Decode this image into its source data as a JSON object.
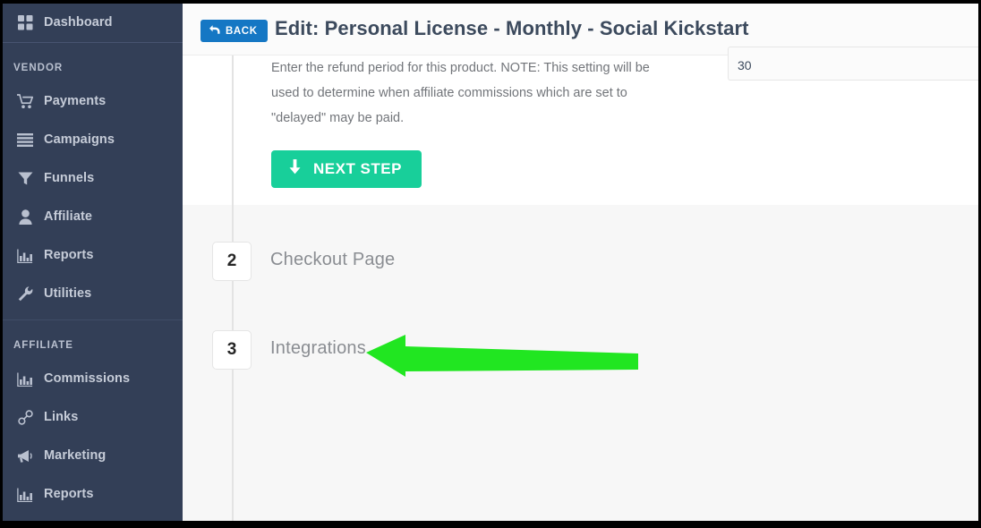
{
  "colors": {
    "sidebar_bg": "#333f57",
    "accent_blue": "#1577c4",
    "accent_green": "#18cf9a",
    "annotation_green": "#21e621",
    "title_text": "#3c4a5d"
  },
  "sidebar": {
    "primary": [
      {
        "label": "Dashboard",
        "icon": "grid-icon"
      }
    ],
    "sections": [
      {
        "heading": "VENDOR",
        "items": [
          {
            "label": "Payments",
            "icon": "cart-icon"
          },
          {
            "label": "Campaigns",
            "icon": "list-icon"
          },
          {
            "label": "Funnels",
            "icon": "funnel-icon"
          },
          {
            "label": "Affiliate",
            "icon": "user-icon"
          },
          {
            "label": "Reports",
            "icon": "bar-chart-icon"
          },
          {
            "label": "Utilities",
            "icon": "wrench-icon"
          }
        ]
      },
      {
        "heading": "AFFILIATE",
        "items": [
          {
            "label": "Commissions",
            "icon": "bar-chart-icon"
          },
          {
            "label": "Links",
            "icon": "link-icon"
          },
          {
            "label": "Marketing",
            "icon": "megaphone-icon"
          },
          {
            "label": "Reports",
            "icon": "bar-chart-icon"
          }
        ]
      }
    ]
  },
  "header": {
    "back_label": "BACK",
    "back_icon": "back-arrow-icon",
    "title": "Edit: Personal License - Monthly - Social Kickstart"
  },
  "step_one": {
    "help_text": "Enter the refund period for this product. NOTE: This setting will be used to determine when affiliate commissions which are set to \"delayed\" may be paid.",
    "refund_field": {
      "value": "30",
      "placeholder": ""
    },
    "next_step": {
      "label": "NEXT STEP",
      "icon": "arrow-down-icon"
    }
  },
  "steps": [
    {
      "number": "2",
      "label": "Checkout Page"
    },
    {
      "number": "3",
      "label": "Integrations"
    }
  ],
  "annotation": {
    "type": "arrow-left",
    "points_to": "Integrations"
  }
}
